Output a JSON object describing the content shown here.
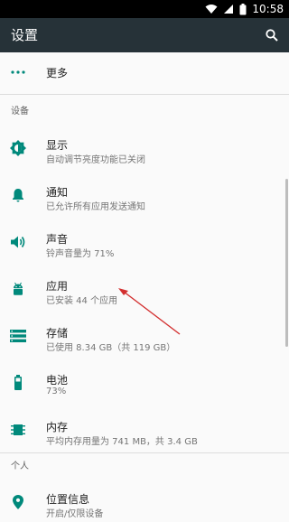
{
  "status_bar": {
    "time": "10:58",
    "icons": [
      "wifi-icon",
      "signal-icon",
      "battery-icon"
    ]
  },
  "app_bar": {
    "title": "设置",
    "search_icon": "search-icon"
  },
  "items": {
    "more": {
      "title": "更多",
      "icon": "more-dots-icon"
    },
    "device_header": "设备",
    "display": {
      "title": "显示",
      "summary": "自动调节亮度功能已关闭",
      "icon": "brightness-icon"
    },
    "notifications": {
      "title": "通知",
      "summary": "已允许所有应用发送通知",
      "icon": "bell-icon"
    },
    "sound": {
      "title": "声音",
      "summary": "铃声音量为 71%",
      "icon": "volume-icon"
    },
    "apps": {
      "title": "应用",
      "summary": "已安装 44 个应用",
      "icon": "android-icon"
    },
    "storage": {
      "title": "存储",
      "summary": "已使用 8.34 GB（共 119 GB）",
      "icon": "storage-icon"
    },
    "battery": {
      "title": "电池",
      "summary": "73%",
      "icon": "battery-icon"
    },
    "memory": {
      "title": "内存",
      "summary": "平均内存用量为 741 MB，共 3.4 GB",
      "icon": "memory-icon"
    },
    "personal_header": "个人",
    "location": {
      "title": "位置信息",
      "summary": "开启/仅限设备",
      "icon": "location-pin-icon"
    }
  },
  "colors": {
    "accent": "#00897b",
    "app_bar": "#263238",
    "annotation": "#d32f2f"
  }
}
